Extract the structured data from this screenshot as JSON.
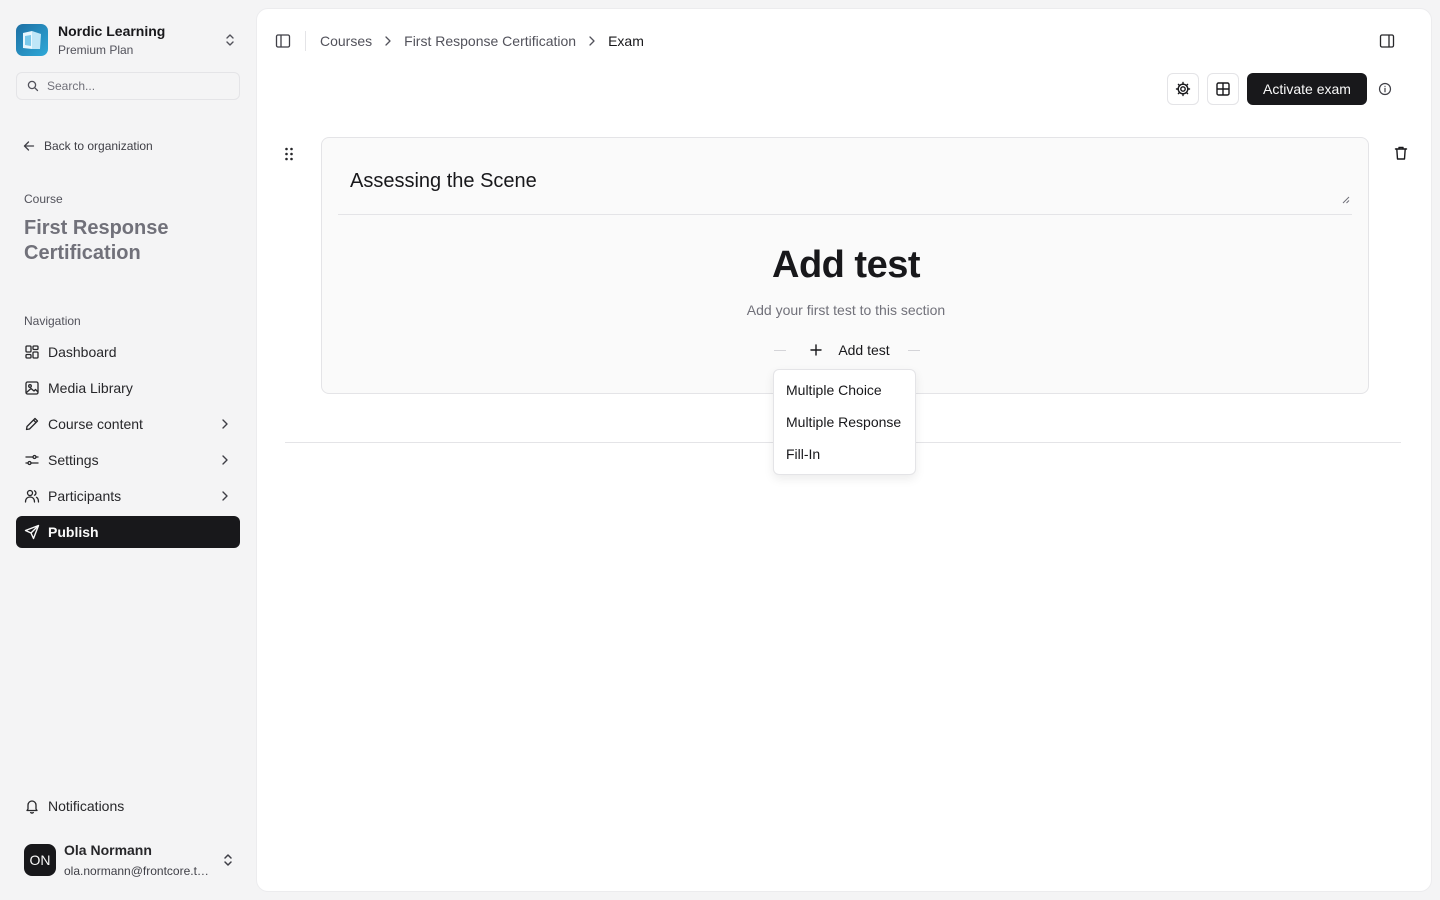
{
  "org": {
    "name": "Nordic Learning",
    "plan": "Premium Plan"
  },
  "search": {
    "placeholder": "Search..."
  },
  "back": {
    "label": "Back to organization"
  },
  "course": {
    "label": "Course",
    "title": "First Response Certification"
  },
  "nav": {
    "label": "Navigation",
    "items": [
      {
        "label": "Dashboard",
        "icon": "dashboard-icon"
      },
      {
        "label": "Media Library",
        "icon": "image-icon"
      },
      {
        "label": "Course content",
        "icon": "pencil-icon"
      },
      {
        "label": "Settings",
        "icon": "sliders-icon"
      },
      {
        "label": "Participants",
        "icon": "users-icon"
      },
      {
        "label": "Publish",
        "icon": "send-icon",
        "active": true
      }
    ]
  },
  "notifications": {
    "label": "Notifications"
  },
  "user": {
    "initials": "ON",
    "name": "Ola Normann",
    "email": "ola.normann@frontcore.tech"
  },
  "breadcrumb": {
    "items": [
      "Courses",
      "First Response Certification",
      "Exam"
    ]
  },
  "toolbar": {
    "activate_label": "Activate exam"
  },
  "section": {
    "title": "Assessing the Scene",
    "empty_title": "Add test",
    "empty_subtitle": "Add your first test to this section",
    "add_label": "Add test"
  },
  "dropdown": {
    "options": [
      "Multiple Choice",
      "Multiple Response",
      "Fill-In"
    ]
  },
  "colors": {
    "primary": "#18181b",
    "background": "#f4f4f5",
    "card": "#fafafa",
    "border": "#e4e4e7"
  }
}
